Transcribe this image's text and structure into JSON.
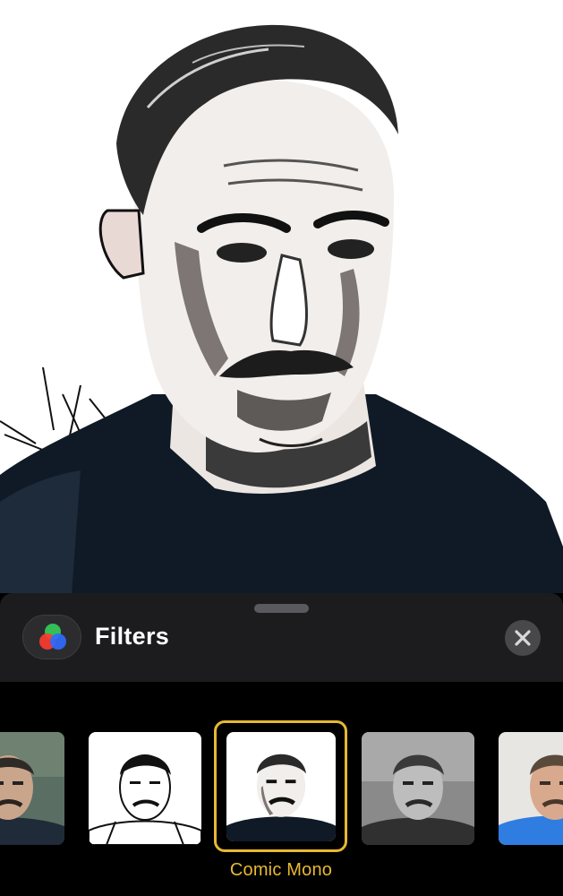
{
  "sheet": {
    "title": "Filters",
    "badge_icon": "filters-venn-icon",
    "close_icon": "close-icon"
  },
  "filters": {
    "items": [
      {
        "style": "vivid-color"
      },
      {
        "style": "ink-outline"
      },
      {
        "style": "comic-mono",
        "label": "Comic Mono",
        "selected": true
      },
      {
        "style": "grayscale"
      },
      {
        "style": "natural-color"
      }
    ]
  },
  "colors": {
    "accent": "#e8b834",
    "sheet_background": "#1c1c1e",
    "close_button": "#48484a",
    "badge_red": "#ff3b30",
    "badge_green": "#34c759",
    "badge_blue": "#2f6bff"
  }
}
